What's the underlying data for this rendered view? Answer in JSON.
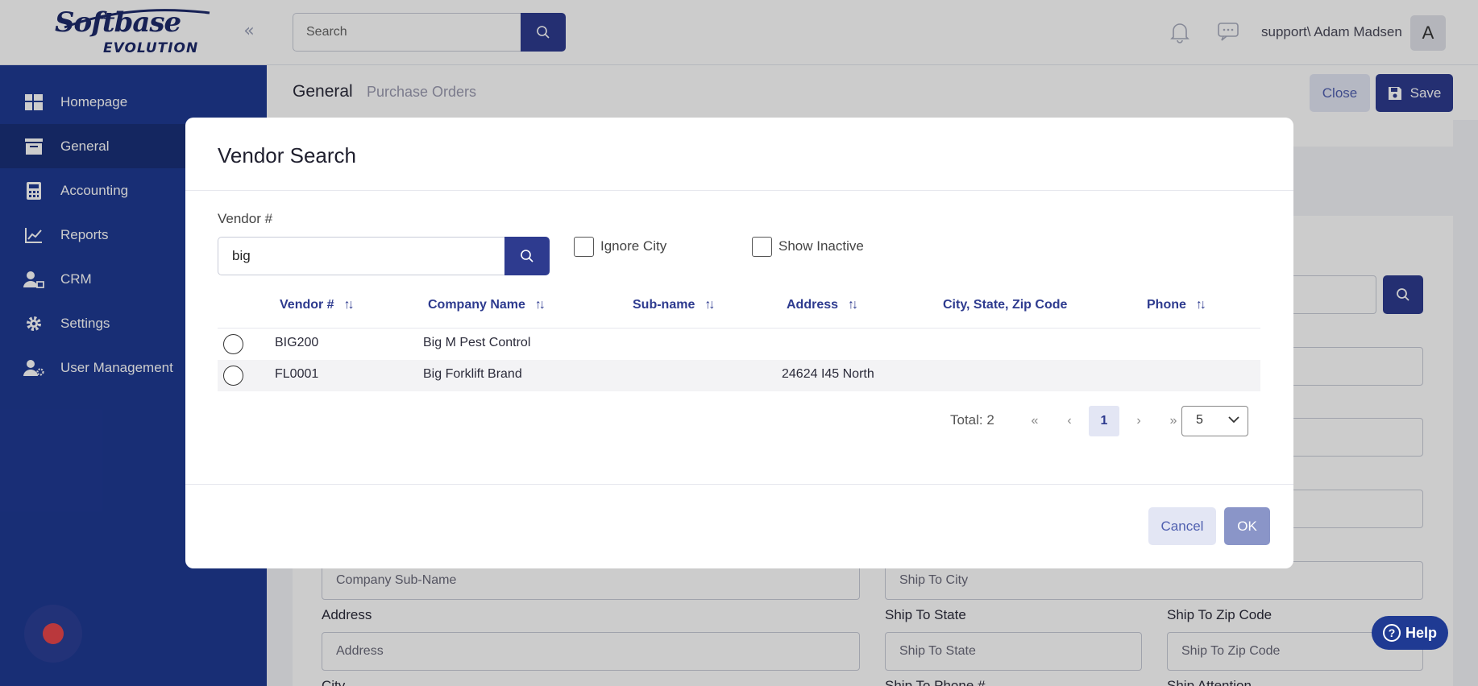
{
  "header": {
    "logo_main": "Softbase",
    "logo_sub": "EVOLUTION",
    "search_placeholder": "Search",
    "user_name": "support\\ Adam Madsen",
    "avatar_letter": "A"
  },
  "sidebar": {
    "items": [
      {
        "label": "Homepage",
        "icon": "dashboard-icon"
      },
      {
        "label": "General",
        "icon": "inbox-icon"
      },
      {
        "label": "Accounting",
        "icon": "calculator-icon"
      },
      {
        "label": "Reports",
        "icon": "chart-icon"
      },
      {
        "label": "CRM",
        "icon": "users-icon"
      },
      {
        "label": "Settings",
        "icon": "gear-icon"
      },
      {
        "label": "User Management",
        "icon": "user-gear-icon"
      }
    ],
    "active": "General"
  },
  "page": {
    "tabs": [
      "General",
      "Purchase Orders"
    ],
    "close_label": "Close",
    "save_label": "Save",
    "fields": {
      "company_sub_name_placeholder": "Company Sub-Name",
      "address_label": "Address",
      "address_placeholder": "Address",
      "city_label": "City",
      "ship_to_city_placeholder": "Ship To City",
      "ship_to_state_label": "Ship To State",
      "ship_to_state_placeholder": "Ship To State",
      "ship_to_zip_label": "Ship To Zip Code",
      "ship_to_zip_placeholder": "Ship To Zip Code",
      "ship_to_phone_label": "Ship To Phone #",
      "ship_attention_label": "Ship Attention"
    },
    "help_label": "Help"
  },
  "modal": {
    "title": "Vendor Search",
    "vendor_label": "Vendor #",
    "vendor_value": "big",
    "ignore_city_label": "Ignore City",
    "show_inactive_label": "Show Inactive",
    "columns": [
      "Vendor #",
      "Company Name",
      "Sub-name",
      "Address",
      "City, State, Zip Code",
      "Phone"
    ],
    "rows": [
      {
        "vendor": "BIG200",
        "company": "Big M Pest Control",
        "subname": "",
        "address": "",
        "city": "",
        "phone": ""
      },
      {
        "vendor": "FL0001",
        "company": "Big Forklift Brand",
        "subname": "",
        "address": "24624 I45 North",
        "city": "",
        "phone": ""
      }
    ],
    "total_label": "Total: 2",
    "current_page": "1",
    "page_size": "5",
    "cancel_label": "Cancel",
    "ok_label": "OK"
  },
  "colors": {
    "brand": "#1f3a93",
    "primary_button": "#2e3b8f",
    "record": "#e9474c"
  }
}
